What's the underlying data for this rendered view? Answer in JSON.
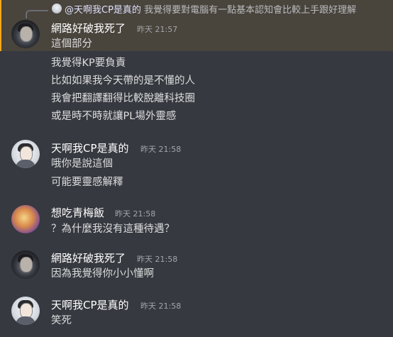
{
  "reply": {
    "mention": "@天啊我CP是真的",
    "text": "我覺得要對電腦有一點基本認知會比較上手跟好理解"
  },
  "messages": [
    {
      "author": "網路好破我死了",
      "time": "昨天 21:57",
      "lines": [
        "這個部分",
        "我覺得KP要負責",
        "比如如果我今天帶的是不懂的人",
        "我會把翻譯翻得比較脫離科技圈",
        "或是時不時就讓PL場外靈感"
      ]
    },
    {
      "author": "天啊我CP是真的",
      "time": "昨天 21:58",
      "lines": [
        "哦你是說這個",
        "可能要靈感解釋"
      ]
    },
    {
      "author": "想吃青梅飯",
      "time": "昨天 21:58",
      "lines": [
        "？為什麼我沒有這種待遇？"
      ]
    },
    {
      "author": "網路好破我死了",
      "time": "昨天 21:58",
      "lines": [
        "因為我覺得你小小懂啊"
      ]
    },
    {
      "author": "天啊我CP是真的",
      "time": "昨天 21:58",
      "lines": [
        "笑死"
      ]
    }
  ],
  "colors": {
    "background": "#36393f",
    "highlight": "#49443c",
    "highlight_bar": "#faa81a",
    "username": "#ffffff",
    "text": "#dcddde",
    "timestamp": "#a3a6aa"
  }
}
